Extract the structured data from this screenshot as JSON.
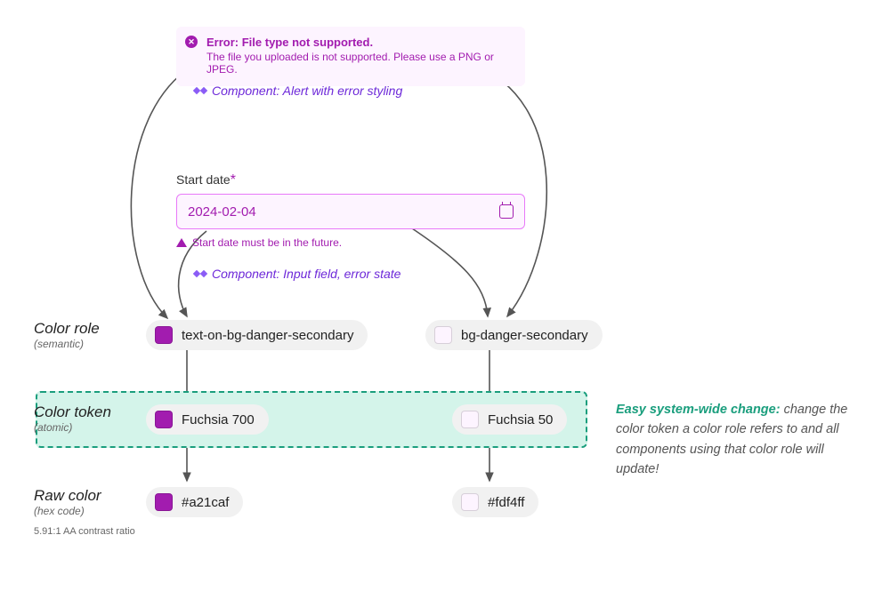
{
  "alert": {
    "title": "Error: File type not supported.",
    "body": "The file you uploaded is not supported. Please use a PNG or JPEG."
  },
  "captions": {
    "alert": "Component: Alert with error styling",
    "input": "Component: Input field, error state"
  },
  "field": {
    "label": "Start date",
    "required_marker": "*",
    "value": "2024-02-04",
    "error": "Start date must be in the future."
  },
  "layers": {
    "role": {
      "title": "Color role",
      "sub": "(semantic)"
    },
    "token": {
      "title": "Color token",
      "sub": "(atomic)"
    },
    "raw": {
      "title": "Raw color",
      "sub": "(hex code)",
      "note": "5.91:1 AA contrast ratio"
    }
  },
  "roles": {
    "text": "text-on-bg-danger-secondary",
    "bg": "bg-danger-secondary"
  },
  "tokens": {
    "text": "Fuchsia 700",
    "bg": "Fuchsia 50"
  },
  "raw": {
    "text": "#a21caf",
    "bg": "#fdf4ff"
  },
  "explainer": {
    "lead": "Easy system-wide change:",
    "body": " change the color token a color role refers to and all components using that color role will update!"
  },
  "colors": {
    "fuchsia700": "#a21caf",
    "fuchsia50": "#fdf4ff",
    "teal": "#1a9e7d",
    "violet": "#6d28d9"
  }
}
